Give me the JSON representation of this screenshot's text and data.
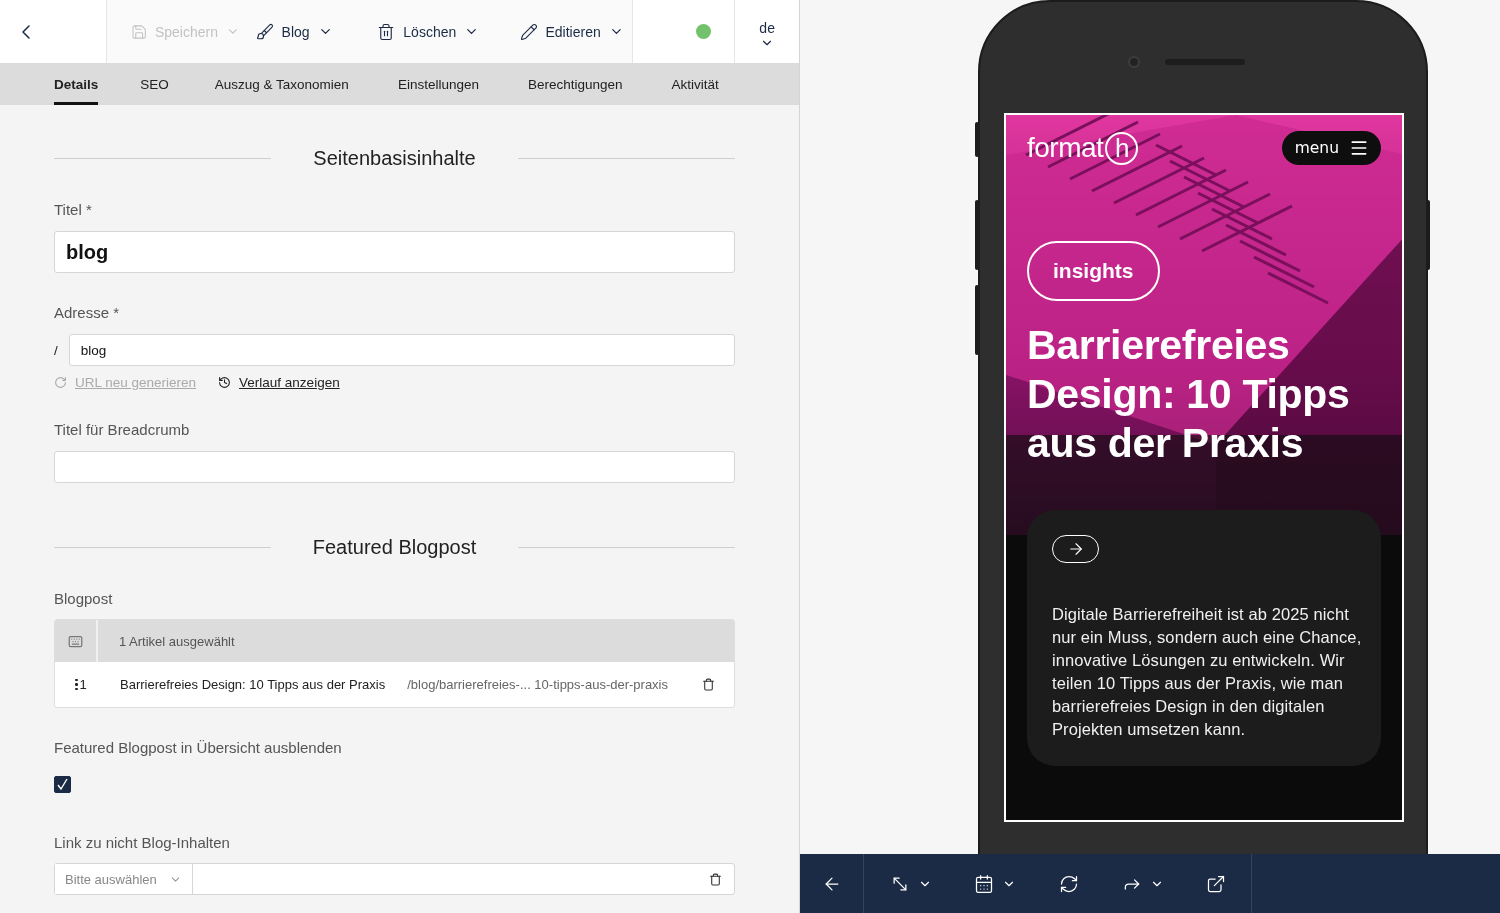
{
  "toolbar": {
    "actions": [
      {
        "kind": "save",
        "label": "Speichern",
        "disabled": true
      },
      {
        "kind": "brush",
        "label": "Blog",
        "disabled": false
      },
      {
        "kind": "trash",
        "label": "Löschen",
        "disabled": false
      },
      {
        "kind": "edit",
        "label": "Editieren",
        "disabled": false
      }
    ],
    "online": true,
    "language": "de"
  },
  "tabs": [
    {
      "label": "Details",
      "selected": true
    },
    {
      "label": "SEO",
      "selected": false
    },
    {
      "label": "Auszug & Taxonomien",
      "selected": false
    },
    {
      "label": "Einstellungen",
      "selected": false
    },
    {
      "label": "Berechtigungen",
      "selected": false
    },
    {
      "label": "Aktivität",
      "selected": false
    }
  ],
  "form": [
    {
      "kind": "heading",
      "text": "Seitenbasisinhalte"
    },
    {
      "kind": "title",
      "label": "Titel *",
      "value": "blog"
    },
    {
      "kind": "slug",
      "label": "Adresse *",
      "prefix": "/",
      "value": "blog",
      "links": [
        {
          "kind": "regenerate",
          "text": "URL neu generieren",
          "disabled": true
        },
        {
          "kind": "history",
          "text": "Verlauf anzeigen",
          "disabled": false
        }
      ]
    },
    {
      "kind": "text",
      "label": "Titel für Breadcrumb"
    },
    {
      "kind": "heading",
      "text": "Featured Blogpost"
    },
    {
      "kind": "relation",
      "label": "Blogpost",
      "summary": "1 Artikel ausgewählt",
      "rows": [
        {
          "index": "1",
          "title": "Barrierefreies Design: 10 Tipps aus der Praxis",
          "path": "/blog/barrierefreies-... 10-tipps-aus-der-praxis"
        }
      ]
    },
    {
      "kind": "checkbox",
      "label": "Featured Blogpost in Übersicht ausblenden",
      "checked": true
    },
    {
      "kind": "link",
      "label": "Link zu nicht Blog-Inhalten",
      "placeholder": "Bitte auswählen"
    }
  ],
  "preview": {
    "logo": {
      "word": "format",
      "mark": "h"
    },
    "menu": "menu",
    "badge": "insights",
    "headline": "Barrierefreies Design: 10 Tipps aus der Praxis",
    "text": "Digitale Barrierefreiheit ist ab 2025 nicht nur ein Muss, sondern auch eine Chance, innovative Lösungen zu entwickeln. Wir teilen 10 Tipps aus der Praxis, wie man barrierefreies Design in den digitalen Projekten umsetzen kann."
  },
  "preview_toolbar": [
    {
      "kind": "back",
      "dropdown": false
    },
    {
      "kind": "resize",
      "dropdown": true
    },
    {
      "kind": "calendar",
      "dropdown": true
    },
    {
      "kind": "refresh",
      "dropdown": false
    },
    {
      "kind": "share",
      "dropdown": true
    },
    {
      "kind": "external",
      "dropdown": false
    }
  ]
}
